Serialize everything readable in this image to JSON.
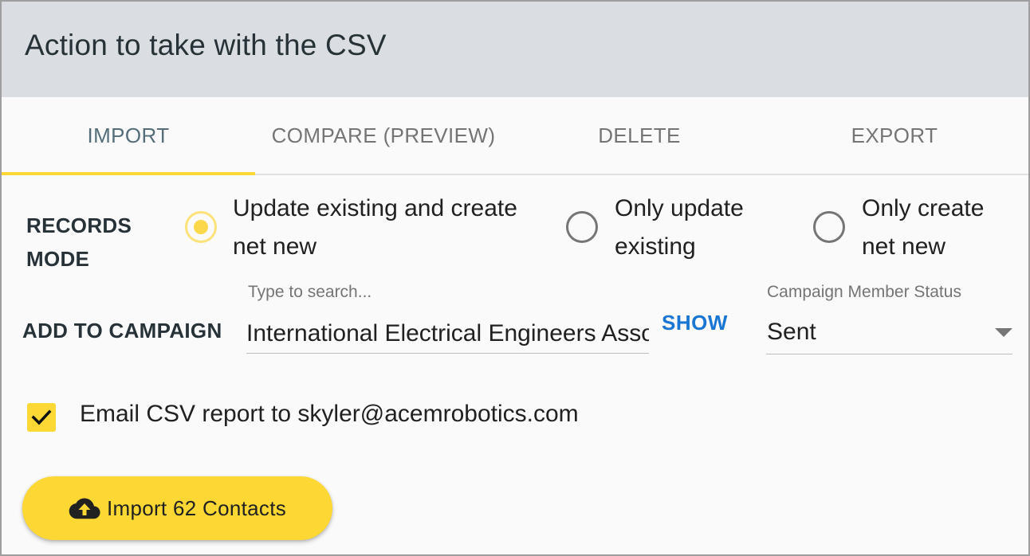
{
  "header": {
    "title": "Action to take with the CSV"
  },
  "tabs": [
    {
      "label": "IMPORT",
      "active": true
    },
    {
      "label": "COMPARE (PREVIEW)",
      "active": false
    },
    {
      "label": "DELETE",
      "active": false
    },
    {
      "label": "EXPORT",
      "active": false
    }
  ],
  "records_mode": {
    "label_line1": "RECORDS",
    "label_line2": "MODE",
    "options": [
      {
        "line1": "Update existing and create",
        "line2": "net new",
        "selected": true
      },
      {
        "line1": "Only update",
        "line2": "existing",
        "selected": false
      },
      {
        "line1": "Only create",
        "line2": "net new",
        "selected": false
      }
    ]
  },
  "campaign": {
    "label": "ADD TO CAMPAIGN",
    "search_hint": "Type to search...",
    "search_value": "International Electrical Engineers Association",
    "show_label": "SHOW",
    "status_hint": "Campaign Member Status",
    "status_value": "Sent"
  },
  "email_report": {
    "checked": true,
    "label": "Email CSV report to skyler@acemrobotics.com"
  },
  "import_button": {
    "label": "Import 62 Contacts",
    "icon": "cloud-upload-icon"
  },
  "colors": {
    "accent": "#fdd835",
    "header_bg": "#dadee2",
    "active_tab": "#546e7a",
    "link": "#1976d2"
  }
}
